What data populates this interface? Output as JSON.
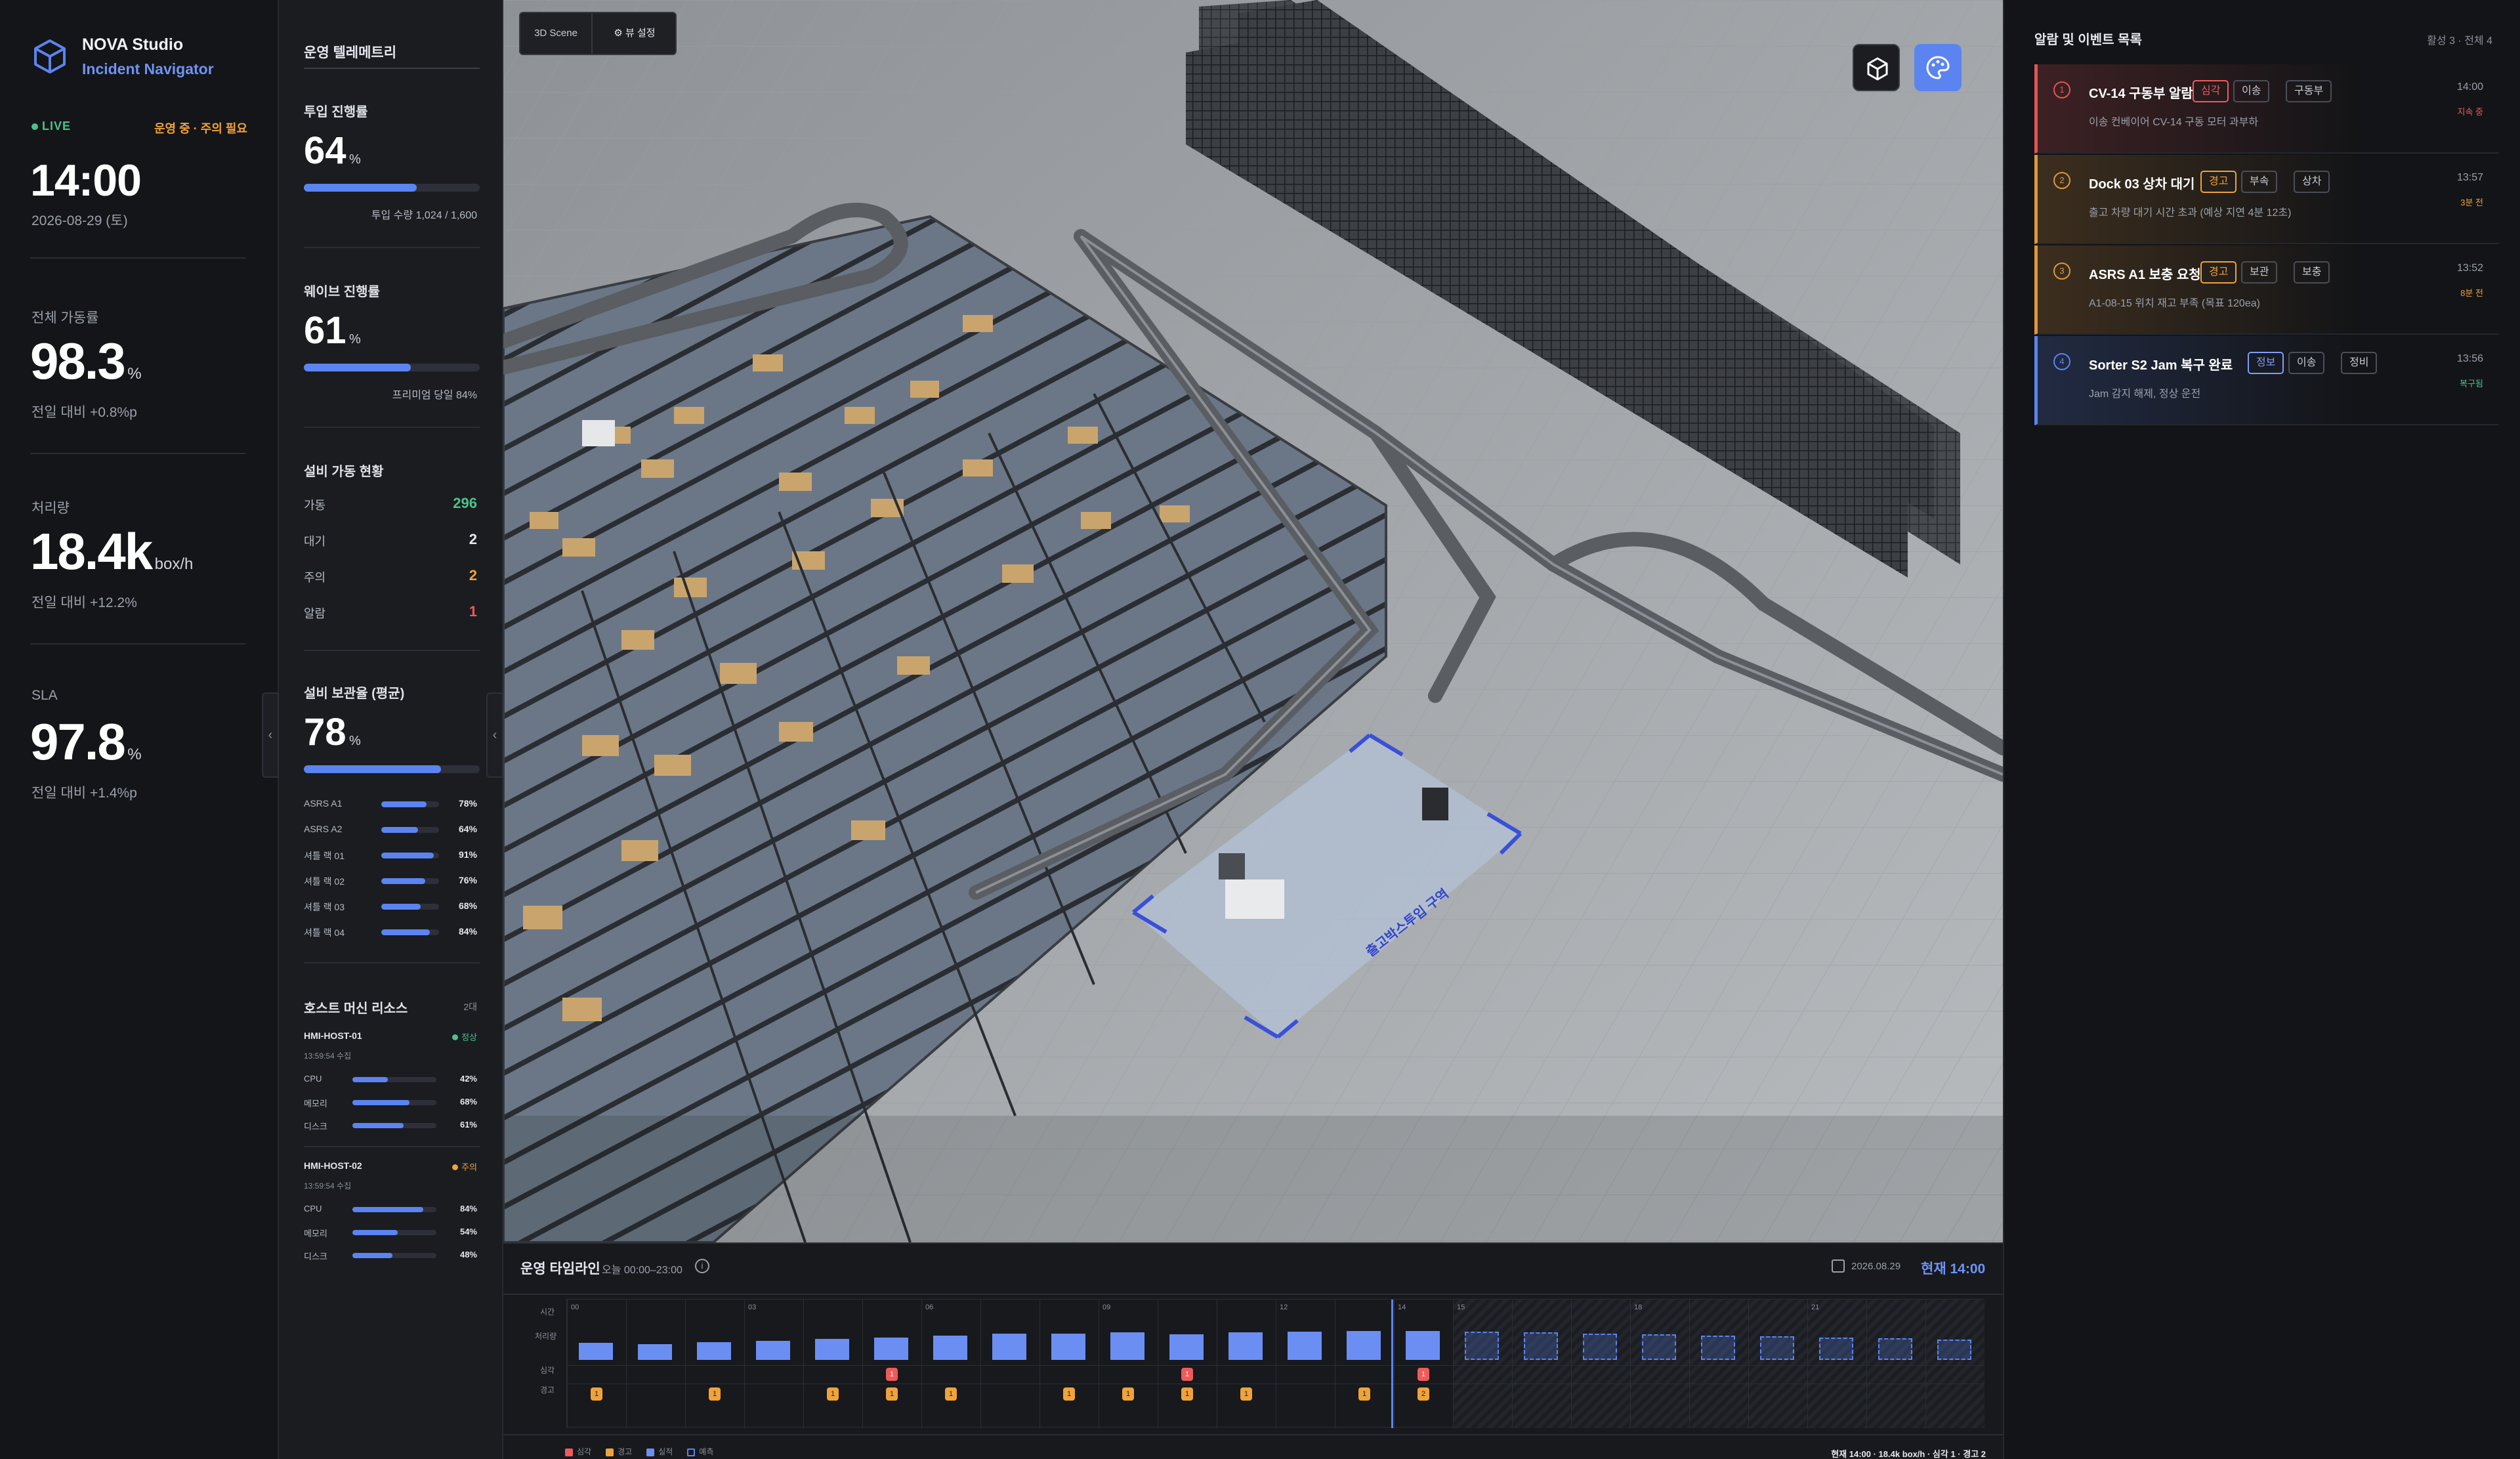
{
  "app": {
    "name": "NOVA Studio",
    "subtitle": "Incident Navigator"
  },
  "status": {
    "live": "LIVE",
    "mode": "운영 중 · 주의 필요",
    "time": "14:00",
    "date": "2026-08-29 (토)"
  },
  "kpis": [
    {
      "label": "전체 가동률",
      "value": "98.3",
      "unit": "%",
      "delta": "전일 대비 +0.8%p"
    },
    {
      "label": "처리량",
      "value": "18.4k",
      "unit": "box/h",
      "delta": "전일 대비 +12.2%"
    },
    {
      "label": "SLA",
      "value": "97.8",
      "unit": "%",
      "delta": "전일 대비 +1.4%p"
    }
  ],
  "telemetry": {
    "title": "운영 텔레메트리",
    "input": {
      "label": "투입 진행률",
      "value": "64",
      "unit": "%",
      "progress": 0.64,
      "note": "투입 수량 1,024 / 1,600"
    },
    "wave": {
      "label": "웨이브 진행률",
      "value": "61",
      "unit": "%",
      "progress": 0.61,
      "note": "프리미엄 당일 84%"
    },
    "equipment": {
      "label": "설비 가동 현황",
      "rows": [
        {
          "label": "가동",
          "value": "296",
          "color": "#4cc28b"
        },
        {
          "label": "대기",
          "value": "2",
          "color": "#e4e7ee"
        },
        {
          "label": "주의",
          "value": "2",
          "color": "#f0a23b"
        },
        {
          "label": "알람",
          "value": "1",
          "color": "#ef5a5a"
        }
      ]
    },
    "storage": {
      "label": "설비 보관율 (평균)",
      "value": "78",
      "unit": "%",
      "progress": 0.78,
      "items": [
        {
          "label": "ASRS A1",
          "value": "78%",
          "progress": 0.78
        },
        {
          "label": "ASRS A2",
          "value": "64%",
          "progress": 0.64
        },
        {
          "label": "셔틀 랙 01",
          "value": "91%",
          "progress": 0.91
        },
        {
          "label": "셔틀 랙 02",
          "value": "76%",
          "progress": 0.76
        },
        {
          "label": "셔틀 랙 03",
          "value": "68%",
          "progress": 0.68
        },
        {
          "label": "셔틀 랙 04",
          "value": "84%",
          "progress": 0.84
        }
      ]
    },
    "hosts": {
      "label": "호스트 머신 리소스",
      "count": "2대",
      "items": [
        {
          "name": "HMI-HOST-01",
          "time": "13:59:54 수집",
          "status": "정상",
          "statusColor": "#4cc28b",
          "metrics": [
            {
              "label": "CPU",
              "value": "42%",
              "progress": 0.42
            },
            {
              "label": "메모리",
              "value": "68%",
              "progress": 0.68
            },
            {
              "label": "디스크",
              "value": "61%",
              "progress": 0.61
            }
          ]
        },
        {
          "name": "HMI-HOST-02",
          "time": "13:59:54 수집",
          "status": "주의",
          "statusColor": "#f0a23b",
          "metrics": [
            {
              "label": "CPU",
              "value": "84%",
              "progress": 0.84
            },
            {
              "label": "메모리",
              "value": "54%",
              "progress": 0.54
            },
            {
              "label": "디스크",
              "value": "48%",
              "progress": 0.48
            }
          ]
        }
      ]
    }
  },
  "scene": {
    "tab": "3D Scene",
    "view": "뷰 설정",
    "zone": "출고박스투입 구역"
  },
  "timeline": {
    "title": "운영 타임라인",
    "range": "오늘 00:00–23:00",
    "date": "2026.08.29",
    "current": "현재 14:00",
    "rows": {
      "time": "시간",
      "throughput": "처리량",
      "critical": "심각",
      "warning": "경고"
    },
    "hour_labels": [
      "00",
      "",
      "",
      "03",
      "",
      "",
      "06",
      "",
      "",
      "09",
      "",
      "",
      "12",
      "",
      "14",
      "15",
      "",
      "",
      "18",
      "",
      "",
      "21",
      "",
      ""
    ],
    "throughput": [
      0.6,
      0.55,
      0.62,
      0.65,
      0.72,
      0.78,
      0.85,
      0.9,
      0.92,
      0.95,
      0.88,
      0.95,
      0.98,
      1.0,
      1.0,
      0.98,
      0.95,
      0.9,
      0.88,
      0.85,
      0.82,
      0.78,
      0.75,
      0.7
    ],
    "forecast_from": 15,
    "critical": {
      "5": "1",
      "10": "1",
      "14": "1"
    },
    "warning": {
      "0": "1",
      "2": "1",
      "4": "1",
      "5": "1",
      "6": "1",
      "8": "1",
      "9": "1",
      "10": "1",
      "11": "1",
      "13": "1",
      "14": "2"
    },
    "legend": [
      "심각",
      "경고",
      "실적",
      "예측"
    ],
    "summary": "현재 14:00 · 18.4k box/h · 심각 1 · 경고 2"
  },
  "alerts": {
    "title": "알람 및 이벤트 목록",
    "meta": "활성 3 · 전체 4",
    "items": [
      {
        "num": "1",
        "title": "CV-14 구동부 알람",
        "level": "심각",
        "tags": [
          "이송",
          "구동부"
        ],
        "desc": "이송 컨베이어 CV-14 구동 모터 과부하",
        "time": "14:00",
        "status": "지속 중",
        "color": "#e35454",
        "levelColor": "#ef5a5a",
        "statusColor": "#ef5a5a"
      },
      {
        "num": "2",
        "title": "Dock 03 상차 대기",
        "level": "경고",
        "tags": [
          "부속",
          "상차"
        ],
        "desc": "출고 차량 대기 시간 초과 (예상 지연 4분 12초)",
        "time": "13:57",
        "status": "3분 전",
        "color": "#e0973a",
        "levelColor": "#f0a23b",
        "statusColor": "#f0a23b"
      },
      {
        "num": "3",
        "title": "ASRS A1 보충 요청",
        "level": "경고",
        "tags": [
          "보관",
          "보충"
        ],
        "desc": "A1-08-15 위치 재고 부족 (목표 120ea)",
        "time": "13:52",
        "status": "8분 전",
        "color": "#e0973a",
        "levelColor": "#f0a23b",
        "statusColor": "#f0a23b"
      },
      {
        "num": "4",
        "title": "Sorter S2 Jam 복구 완료",
        "level": "정보",
        "tags": [
          "이송",
          "정비"
        ],
        "desc": "Jam 감지 해제, 정상 운전",
        "time": "13:56",
        "status": "복구됨",
        "color": "#5b84f1",
        "levelColor": "#7f9ff4",
        "statusColor": "#4cc28b"
      }
    ]
  }
}
